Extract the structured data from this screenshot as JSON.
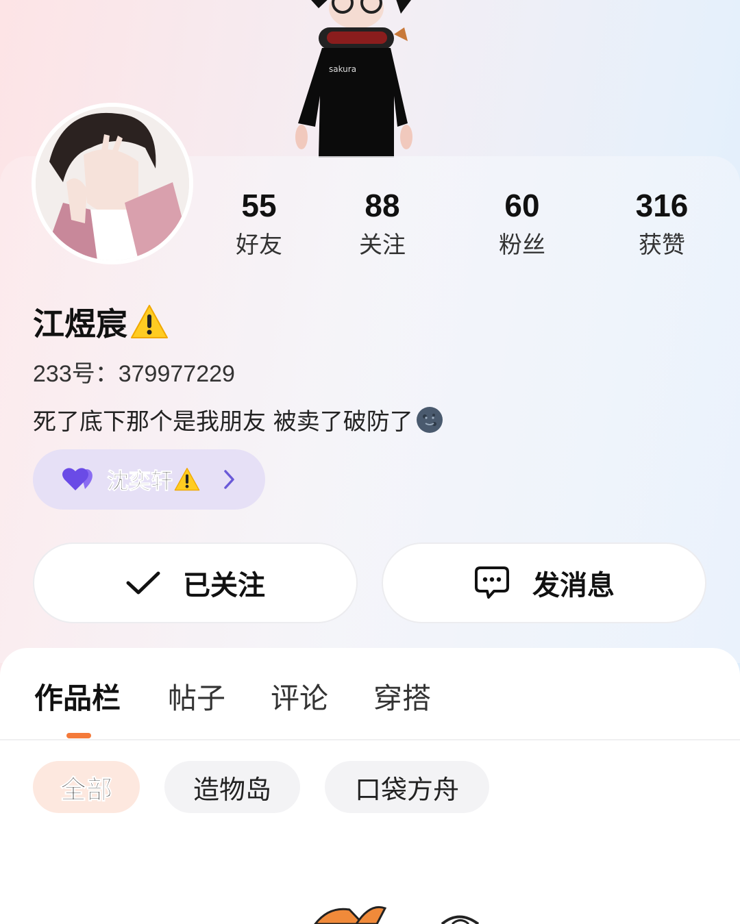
{
  "profile": {
    "name": "江煜宸",
    "uid_label": "233号：",
    "uid_value": "379977229",
    "bio": "死了底下那个是我朋友 被卖了破防了"
  },
  "stats": [
    {
      "value": "55",
      "label": "好友"
    },
    {
      "value": "88",
      "label": "关注"
    },
    {
      "value": "60",
      "label": "粉丝"
    },
    {
      "value": "316",
      "label": "获赞"
    }
  ],
  "cp": {
    "name": "沈奕轩"
  },
  "actions": {
    "follow_label": "已关注",
    "message_label": "发消息"
  },
  "tabs": [
    "作品栏",
    "帖子",
    "评论",
    "穿搭"
  ],
  "filters": [
    "全部",
    "造物岛",
    "口袋方舟"
  ],
  "figure_text": "sakura",
  "colors": {
    "accent": "#f47a3a",
    "cp_bg": "#e6e0f6",
    "heart": "#7a5cf0",
    "active_chip_bg": "#fde8df"
  }
}
